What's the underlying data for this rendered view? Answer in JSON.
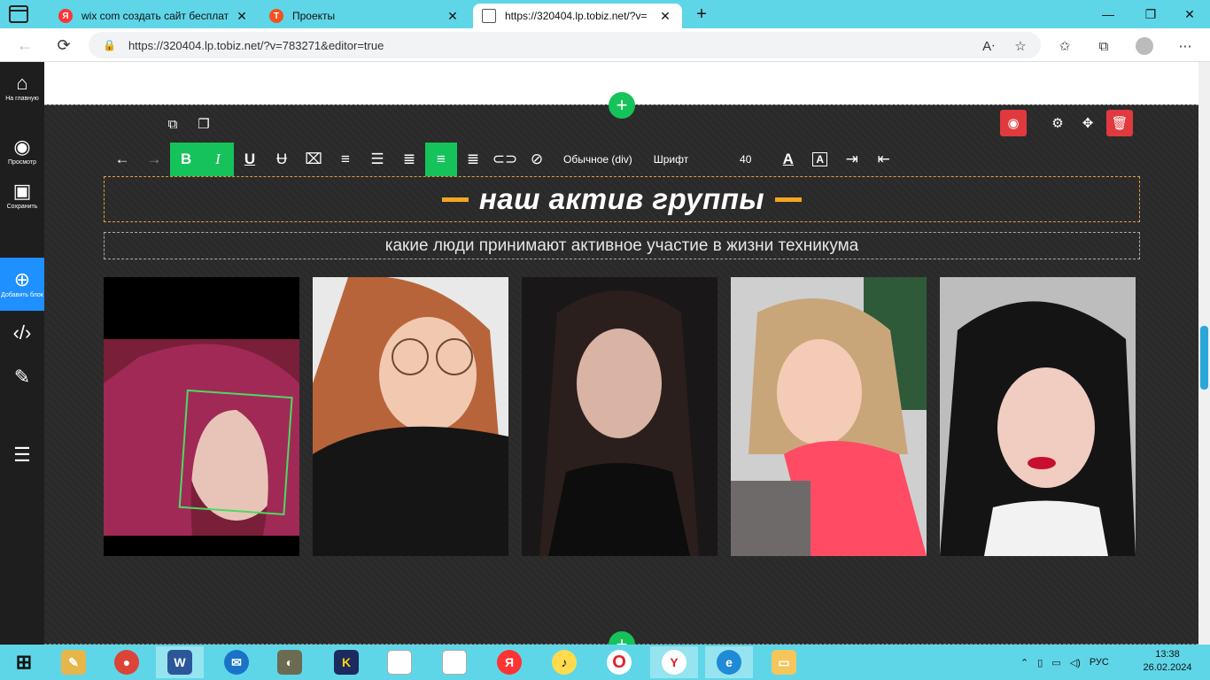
{
  "browser": {
    "tabs": [
      {
        "label": "wix com создать сайт бесплатн",
        "favicon": "yandex-icon",
        "color": "#ff3333",
        "fav_text": "Я"
      },
      {
        "label": "Проекты",
        "favicon": "tilda-icon",
        "color": "#f4511e",
        "fav_text": "T"
      },
      {
        "label": "https://320404.lp.tobiz.net/?v=",
        "favicon": "page-icon",
        "color": "#ffffff",
        "fav_text": ""
      }
    ],
    "url": "https://320404.lp.tobiz.net/?v=783271&editor=true"
  },
  "sidebar": {
    "home_label": "На главную",
    "preview_label": "Просмотр",
    "save_label": "Сохранить",
    "add_block_label": "Добавить блок"
  },
  "toolbar": {
    "format_label": "Обычное (div)",
    "font_label": "Шрифт",
    "font_size": "40",
    "bold": "B",
    "italic": "I",
    "underline": "U",
    "text_color_glyph": "A",
    "bg_color_glyph": "A"
  },
  "content": {
    "title": "наш актив группы",
    "subtitle": "какие люди принимают активное участие в жизни техникума"
  },
  "colors": {
    "accent_green": "#16c25a",
    "accent_orange": "#f5a623",
    "delete_red": "#e0393e",
    "add_block_blue": "#1e90ff"
  },
  "taskbar": {
    "lang": "РУС",
    "time": "13:38",
    "date": "26.02.2024"
  }
}
